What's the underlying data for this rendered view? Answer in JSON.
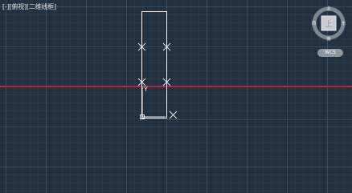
{
  "viewport": {
    "label_prefix": "[-]",
    "label_view": "[俯视]",
    "label_style": "[二维线框]"
  },
  "viewcube": {
    "north": "北",
    "south": "南",
    "west": "西",
    "east": "东",
    "face": "上"
  },
  "wcs_button": "WCS",
  "ucs_icon_label": "Y",
  "colors": {
    "background": "#233040",
    "red_axis": "#b0282e",
    "geometry": "#f0f0f0"
  }
}
